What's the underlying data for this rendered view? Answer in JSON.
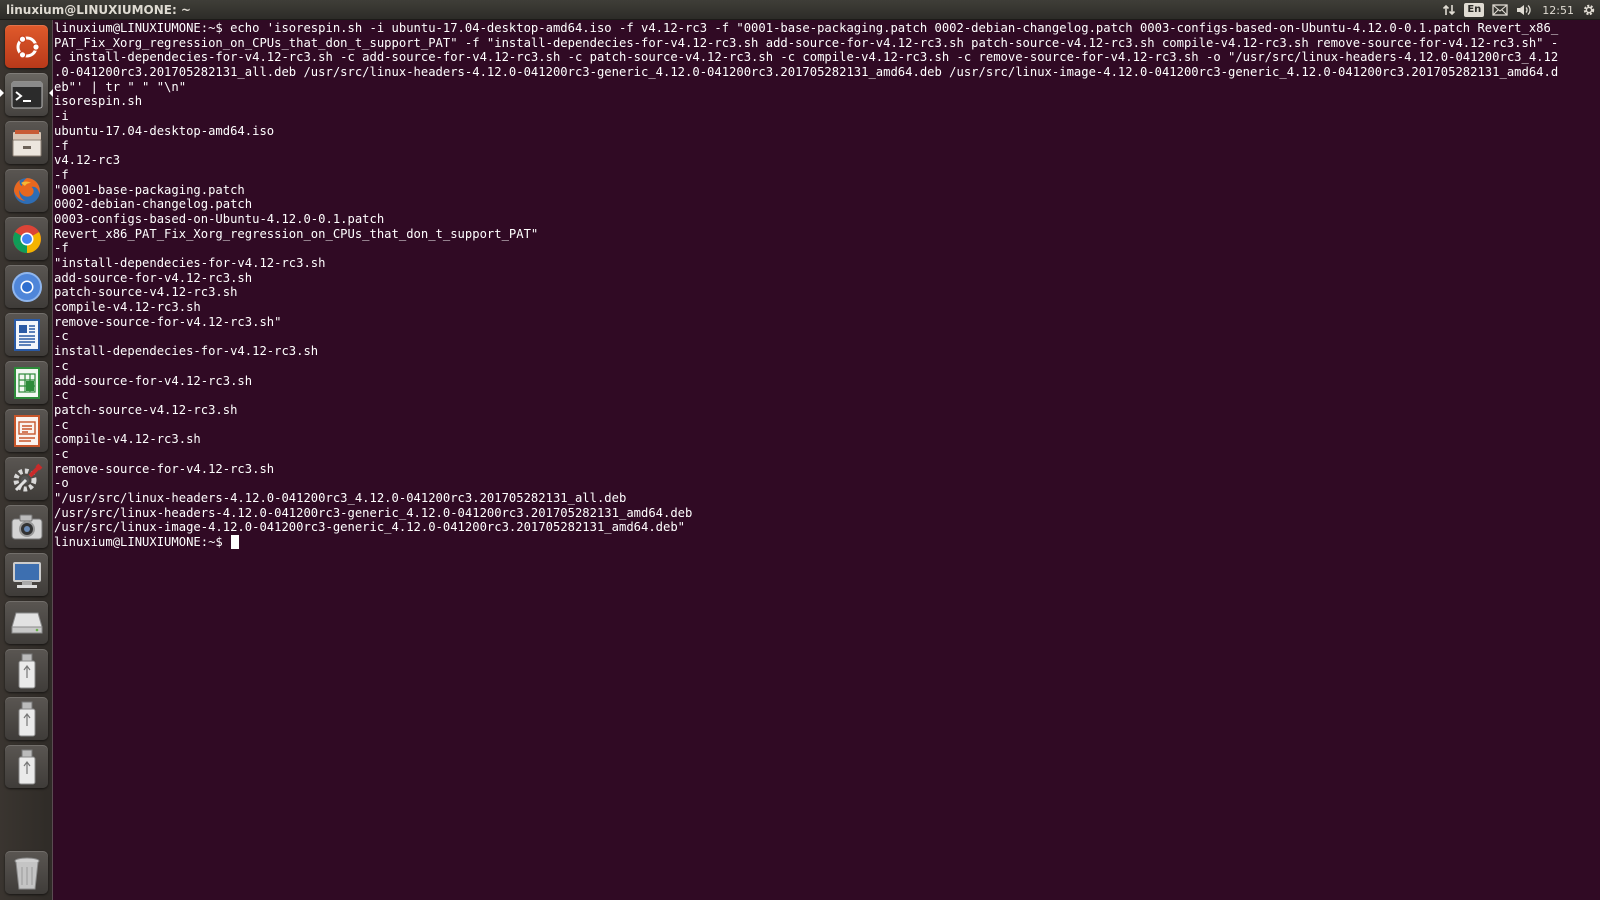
{
  "window": {
    "title": "linuxium@LINUXIUMONE: ~"
  },
  "panel": {
    "language": "En",
    "clock": "12:51",
    "indicator_icons": [
      "network-updown-icon",
      "keyboard-layout-icon",
      "mail-icon",
      "volume-icon",
      "gear-icon"
    ]
  },
  "launcher": {
    "items": [
      {
        "name": "ubuntu-dash-icon"
      },
      {
        "name": "terminal-icon"
      },
      {
        "name": "files-icon"
      },
      {
        "name": "firefox-icon"
      },
      {
        "name": "chrome-icon"
      },
      {
        "name": "chromium-icon"
      },
      {
        "name": "writer-icon"
      },
      {
        "name": "calc-icon"
      },
      {
        "name": "impress-icon"
      },
      {
        "name": "system-settings-icon"
      },
      {
        "name": "camera-icon"
      },
      {
        "name": "remote-desktop-icon"
      },
      {
        "name": "drive-icon"
      },
      {
        "name": "usb-drive-icon"
      },
      {
        "name": "usb-drive-icon"
      },
      {
        "name": "usb-drive-icon"
      },
      {
        "name": "trash-icon"
      }
    ]
  },
  "terminal": {
    "lines": [
      "linuxium@LINUXIUMONE:~$ echo 'isorespin.sh -i ubuntu-17.04-desktop-amd64.iso -f v4.12-rc3 -f \"0001-base-packaging.patch 0002-debian-changelog.patch 0003-configs-based-on-Ubuntu-4.12.0-0.1.patch Revert_x86_",
      "PAT_Fix_Xorg_regression_on_CPUs_that_don_t_support_PAT\" -f \"install-dependecies-for-v4.12-rc3.sh add-source-for-v4.12-rc3.sh patch-source-v4.12-rc3.sh compile-v4.12-rc3.sh remove-source-for-v4.12-rc3.sh\" -",
      "c install-dependecies-for-v4.12-rc3.sh -c add-source-for-v4.12-rc3.sh -c patch-source-v4.12-rc3.sh -c compile-v4.12-rc3.sh -c remove-source-for-v4.12-rc3.sh -o \"/usr/src/linux-headers-4.12.0-041200rc3_4.12",
      ".0-041200rc3.201705282131_all.deb /usr/src/linux-headers-4.12.0-041200rc3-generic_4.12.0-041200rc3.201705282131_amd64.deb /usr/src/linux-image-4.12.0-041200rc3-generic_4.12.0-041200rc3.201705282131_amd64.d",
      "eb\"' | tr \" \" \"\\n\"",
      "isorespin.sh",
      "-i",
      "ubuntu-17.04-desktop-amd64.iso",
      "-f",
      "v4.12-rc3",
      "-f",
      "\"0001-base-packaging.patch",
      "0002-debian-changelog.patch",
      "0003-configs-based-on-Ubuntu-4.12.0-0.1.patch",
      "Revert_x86_PAT_Fix_Xorg_regression_on_CPUs_that_don_t_support_PAT\"",
      "-f",
      "\"install-dependecies-for-v4.12-rc3.sh",
      "add-source-for-v4.12-rc3.sh",
      "patch-source-v4.12-rc3.sh",
      "compile-v4.12-rc3.sh",
      "remove-source-for-v4.12-rc3.sh\"",
      "-c",
      "install-dependecies-for-v4.12-rc3.sh",
      "-c",
      "add-source-for-v4.12-rc3.sh",
      "-c",
      "patch-source-v4.12-rc3.sh",
      "-c",
      "compile-v4.12-rc3.sh",
      "-c",
      "remove-source-for-v4.12-rc3.sh",
      "-o",
      "\"/usr/src/linux-headers-4.12.0-041200rc3_4.12.0-041200rc3.201705282131_all.deb",
      "/usr/src/linux-headers-4.12.0-041200rc3-generic_4.12.0-041200rc3.201705282131_amd64.deb",
      "/usr/src/linux-image-4.12.0-041200rc3-generic_4.12.0-041200rc3.201705282131_amd64.deb\""
    ],
    "prompt": "linuxium@LINUXIUMONE:~$ "
  },
  "colors": {
    "terminal_background": "#300a24",
    "terminal_text": "#ffffff",
    "panel_background": "#3c3b37",
    "panel_text": "#dfdbd2",
    "launcher_background": "#35312d"
  }
}
